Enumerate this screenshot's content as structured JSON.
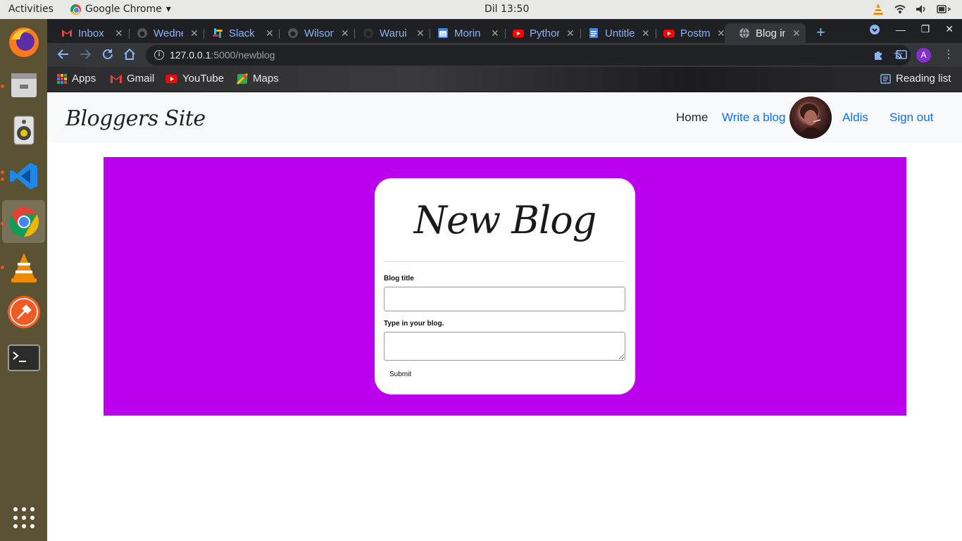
{
  "system": {
    "activities_label": "Activities",
    "app_name": "Google Chrome",
    "clock": "Dil 13:50"
  },
  "dock": {
    "apps": [
      "firefox-icon",
      "files-icon",
      "rhythmbox-icon",
      "vscode-icon",
      "chrome-icon",
      "vlc-icon",
      "postman-icon",
      "terminal-icon",
      "show-apps-icon"
    ]
  },
  "browser": {
    "tabs": [
      {
        "title": "Inbox",
        "icon": "gmail-icon"
      },
      {
        "title": "Wedne",
        "icon": "github-icon"
      },
      {
        "title": "Slack |",
        "icon": "slack-icon"
      },
      {
        "title": "Wilson",
        "icon": "github-icon"
      },
      {
        "title": "Warui",
        "icon": "github-icon"
      },
      {
        "title": "Morin",
        "icon": "calendar-icon"
      },
      {
        "title": "Pythor",
        "icon": "youtube-icon"
      },
      {
        "title": "Untitle",
        "icon": "docs-icon"
      },
      {
        "title": "Postm",
        "icon": "youtube-icon"
      },
      {
        "title": "Blog in",
        "icon": "globe-icon"
      }
    ],
    "url_host": "127.0.0.1",
    "url_rest": ":5000/newblog",
    "profile_initial": "A",
    "bookmarks": {
      "apps": "Apps",
      "gmail": "Gmail",
      "youtube": "YouTube",
      "maps": "Maps",
      "reading_list": "Reading list"
    }
  },
  "site": {
    "brand": "Bloggers Site",
    "nav": {
      "home": "Home",
      "write": "Write a blog",
      "user": "Aldis",
      "signout": "Sign out"
    },
    "hero_color": "#bb00ee",
    "form": {
      "heading": "New Blog",
      "title_label": "Blog title",
      "title_value": "",
      "body_label": "Type in your blog.",
      "body_value": "",
      "submit_label": "Submit"
    }
  }
}
